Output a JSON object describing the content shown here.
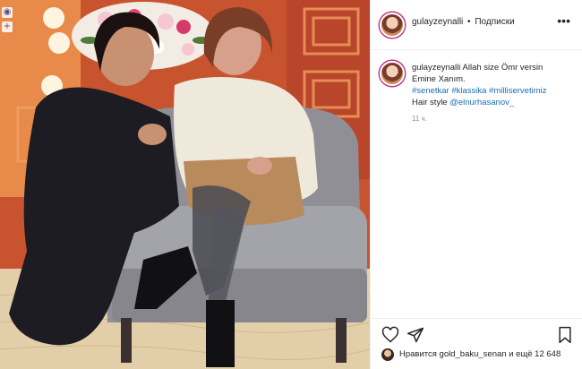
{
  "photo": {
    "description_icons": [
      "camera-icon",
      "plus-icon"
    ]
  },
  "header": {
    "username": "gulayzeynalli",
    "separator": "•",
    "follow_label": "Подписки",
    "more_label": "•••"
  },
  "caption": {
    "username": "gulayzeynalli",
    "text_line1": "Allah size Ömr versin",
    "text_line2": "Emine Xanım.",
    "hashtags": "#senetkar #klassika #milliservetimiz",
    "hair_prefix": "Hair style ",
    "mention": "@elnurhasanov_",
    "time_ago": "11 ч."
  },
  "actions": {
    "icons": [
      "heart-icon",
      "send-icon",
      "bookmark-icon"
    ]
  },
  "likes": {
    "text": "Нравится gold_baku_senan и ещё 12 648"
  },
  "colors": {
    "link": "#1a6fb5",
    "border": "#efefef",
    "muted": "#8e8e8e"
  }
}
